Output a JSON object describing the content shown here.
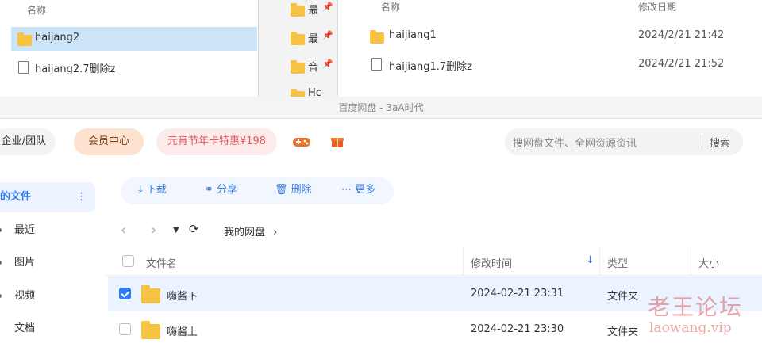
{
  "explorer_left": {
    "col_name": "名称",
    "items": [
      {
        "name": "haijang2",
        "type": "folder",
        "selected": true
      },
      {
        "name": "haijang2.7删除z",
        "type": "file"
      }
    ]
  },
  "explorer_mid": {
    "items": [
      "最",
      "最",
      "音",
      "Hc"
    ]
  },
  "explorer_right": {
    "col_name": "名称",
    "col_date": "修改日期",
    "items": [
      {
        "name": "haijiang1",
        "type": "folder",
        "date": "2024/2/21 21:42"
      },
      {
        "name": "haijiang1.7删除z",
        "type": "file",
        "date": "2024/2/21 21:52"
      }
    ]
  },
  "app": {
    "title": "百度网盘 - 3aA时代",
    "topbar": {
      "team_label": "企业/团队",
      "vip_label": "会员中心",
      "promo_label": "元宵节年卡特惠¥198",
      "game_icon": "gamepad-icon",
      "gift_icon": "gift-icon",
      "search_placeholder": "搜网盘文件、全网资源资讯",
      "search_button": "搜索"
    },
    "sidebar": {
      "items": [
        {
          "label": "的文件",
          "active": true
        },
        {
          "label": "最近"
        },
        {
          "label": "图片"
        },
        {
          "label": "视频"
        },
        {
          "label": "文档"
        }
      ]
    },
    "toolbar": {
      "download": "下载",
      "share": "分享",
      "delete": "删除",
      "more": "更多"
    },
    "breadcrumb": "我的网盘",
    "table": {
      "headers": {
        "name": "文件名",
        "mtime": "修改时间",
        "type": "类型",
        "size": "大小"
      },
      "rows": [
        {
          "name": "嗨酱下",
          "mtime": "2024-02-21 23:31",
          "type": "文件夹",
          "checked": true
        },
        {
          "name": "嗨酱上",
          "mtime": "2024-02-21 23:30",
          "type": "文件夹",
          "checked": false
        }
      ]
    },
    "colors": {
      "accent": "#2f7cf6",
      "vip": "#fde3cf",
      "promo": "#fdeaea"
    }
  },
  "watermark": {
    "cn": "老王论坛",
    "url": "laowang.vip"
  }
}
